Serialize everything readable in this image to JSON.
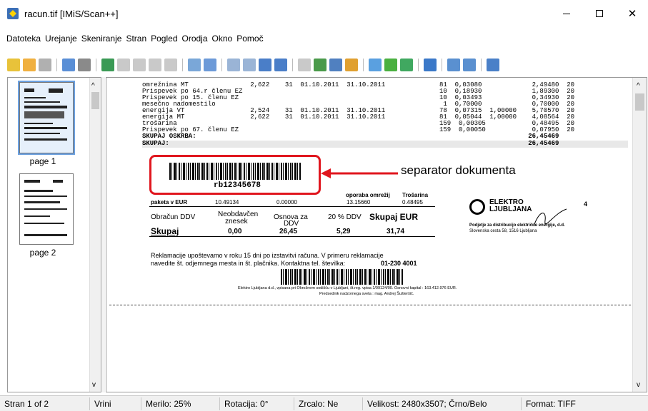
{
  "window": {
    "title": "racun.tif [IMiS/Scan++]",
    "icon": "imis-app-icon",
    "minimize": "minimize",
    "maximize": "maximize",
    "close": "✕"
  },
  "menu": [
    "Datoteka",
    "Urejanje",
    "Skeniranje",
    "Stran",
    "Pogled",
    "Orodja",
    "Okno",
    "Pomoč"
  ],
  "thumbnails": [
    {
      "label": "page 1",
      "selected": true
    },
    {
      "label": "page 2",
      "selected": false
    }
  ],
  "document": {
    "rows": [
      "omrežnina MT                2,622    31  01.10.2011  31.10.2011",
      "Prispevek po 64.r členu EZ",
      "Prispevek po 15. členu EZ",
      "mesečno nadomestilo",
      "energija VT                 2,524    31  01.10.2011  31.10.2011",
      "energija MT                 2,622    31  01.10.2011  31.10.2011",
      "trošarina",
      "Prispevek po 67. členu EZ",
      "SKUPAJ OSKRBA:",
      "SKUPAJ:"
    ],
    "right_rows": [
      "81  0,03080             2,49480  20",
      "10  0,18930             1,89300  20",
      "10  0,03493             0,34930  20",
      " 1  0,70000             0,70000  20",
      "78  0,07315  1,00000    5,70570  20",
      "81  0,05044  1,00000    4,08564  20",
      "159  0,00305            0,48495  20",
      "159  0,00050            0,07950  20",
      "                       26,45469",
      "                       26,45469"
    ],
    "barcode_text": "rb12345678",
    "annotation": "separator dokumenta",
    "paketa_label": "paketa v EUR",
    "paketa_values": [
      "10.49134",
      "0.00000",
      "13.15660",
      "0.48495"
    ],
    "header_oporaba": "oporaba omrežij",
    "header_trosarina": "Trošarina",
    "obracun_ddv": "Obračun DDV",
    "neobdavcen": "Neobdavčen",
    "znesek": "znesek",
    "osnova_za": "Osnova za",
    "ddv": "DDV",
    "pct_ddv": "20 % DDV",
    "skupaj_eur": "Skupaj EUR",
    "skupaj": "Skupaj",
    "v_zero": "0,00",
    "v_osnova": "26,45",
    "v_ddv": "5,29",
    "v_total": "31,74",
    "logo_text": "ELEKTRO LJUBLJANA",
    "company_line1": "Podjetje za distribucijo električne energije, d.d.",
    "company_line2": "Slovenska cesta 58, 1516 Ljubljana",
    "page_num": "4",
    "reklamacije1": "Reklamacije upoštevamo v roku 15  dni po izstavitvi računa. V primeru reklamacije",
    "reklamacije2": "navedite št. odjemnega mesta in  št. plačnika.  Kontaktna tel. številka:",
    "phone": "01-230 4001",
    "footer1": "Elektro Ljubljana d.d., vpisana pri Okrožnem sodišču v Ljubljani, št.reg. vpisa 1/09124/00. Osnovni kapital : 163.412.976 EUR.",
    "footer2": "Predsednik nadzornega sveta : mag. Andrej Šušteršič."
  },
  "status": [
    "Stran 1 of 2",
    "Vrini",
    "Merilo: 25%",
    "Rotacija: 0°",
    "Zrcalo: Ne",
    "Velikost: 2480x3507; Črno/Belo",
    "Format: TIFF"
  ],
  "colors": {
    "annotation_red": "#e0161e",
    "selection_blue": "#6aa0e0"
  }
}
